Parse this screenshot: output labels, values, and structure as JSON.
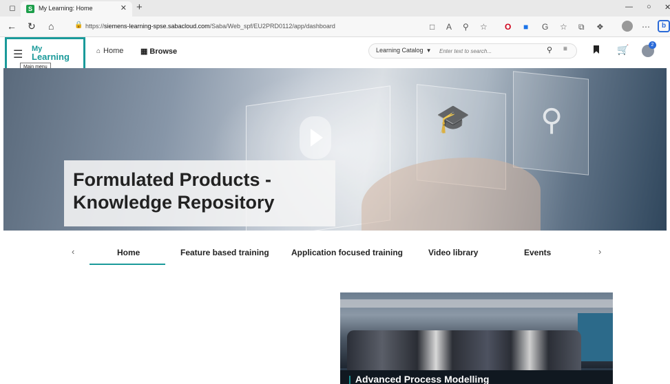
{
  "browser": {
    "tab_title": "My Learning: Home",
    "favicon_letter": "S",
    "url_prefix": "https://",
    "url_host": "siemens-learning-spse.sabacloud.com",
    "url_path": "/Saba/Web_spf/EU2PRD0112/app/dashboard"
  },
  "app": {
    "logo_my": "My",
    "logo_learning": "Learning",
    "tooltip": "Main menu",
    "nav": {
      "home": "Home",
      "browse": "Browse"
    },
    "search": {
      "catalog_label": "Learning Catalog",
      "placeholder": "Enter text to search..."
    },
    "notification_count": "2"
  },
  "hero": {
    "title_line1": "Formulated Products -",
    "title_line2": "Knowledge Repository"
  },
  "tabs": [
    {
      "label": "Home"
    },
    {
      "label": "Feature based training"
    },
    {
      "label": "Application focused training"
    },
    {
      "label": "Video library"
    },
    {
      "label": "Events"
    }
  ],
  "card": {
    "title": "Advanced Process Modelling"
  },
  "colors": {
    "accent": "#1a9a9a",
    "highlight_box": "#1a9a9a"
  }
}
